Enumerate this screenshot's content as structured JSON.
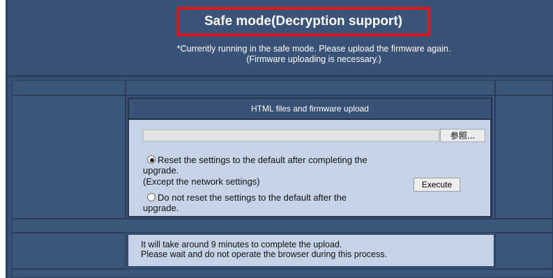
{
  "header": {
    "title": "Safe mode(Decryption support)",
    "notice_line1": "*Currently running in the safe mode. Please upload the firmware again.",
    "notice_line2": "(Firmware uploading is necessary.)"
  },
  "upload": {
    "section_title": "HTML files and firmware upload",
    "file_value": "",
    "browse_label": "参照...",
    "option_reset": {
      "line1": "Reset the settings to the default after completing the",
      "line2": "upgrade.",
      "line3": "(Except the network settings)",
      "selected": true
    },
    "option_no_reset": {
      "line1": "Do not reset the settings to the default after the",
      "line2": "upgrade.",
      "selected": false
    },
    "execute_label": "Execute"
  },
  "info": {
    "line1": "It will take around 9 minutes to complete the upload.",
    "line2": "Please wait and do not operate the browser during this process."
  },
  "colors": {
    "background": "#384f74",
    "title_border": "#e2151b",
    "panel": "#c4d3e6"
  }
}
